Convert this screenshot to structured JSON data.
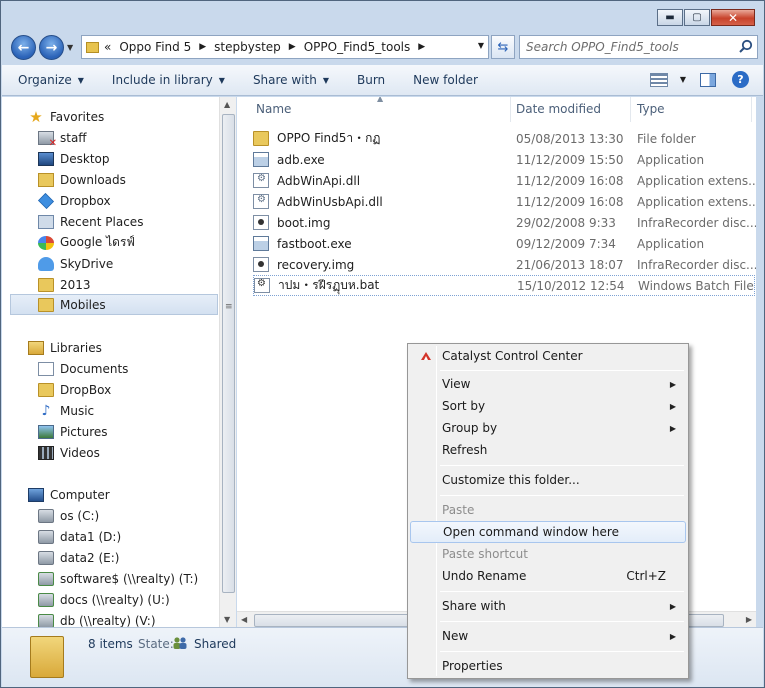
{
  "window": {
    "minimize_label": "▬",
    "maximize_label": "▢",
    "close_label": "✕"
  },
  "address": {
    "chevron": "«",
    "crumbs": [
      "Oppo Find 5",
      "stepbystep",
      "OPPO_Find5_tools"
    ],
    "search_placeholder": "Search OPPO_Find5_tools"
  },
  "toolbar": {
    "organize": "Organize",
    "include": "Include in library",
    "share": "Share with",
    "burn": "Burn",
    "new_folder": "New folder"
  },
  "sidebar": {
    "favorites": {
      "header": "Favorites",
      "items": [
        {
          "label": "staff",
          "icon": "network-drive-disconnected-icon"
        },
        {
          "label": "Desktop",
          "icon": "desktop-icon"
        },
        {
          "label": "Downloads",
          "icon": "downloads-icon"
        },
        {
          "label": "Dropbox",
          "icon": "dropbox-icon"
        },
        {
          "label": "Recent Places",
          "icon": "recent-places-icon"
        },
        {
          "label": "Google ไดรฟ์",
          "icon": "google-drive-icon"
        },
        {
          "label": "SkyDrive",
          "icon": "skydrive-icon"
        },
        {
          "label": "2013",
          "icon": "folder-icon"
        },
        {
          "label": "Mobiles",
          "icon": "folder-icon"
        }
      ]
    },
    "libraries": {
      "header": "Libraries",
      "items": [
        {
          "label": "Documents",
          "icon": "documents-icon"
        },
        {
          "label": "DropBox",
          "icon": "folder-icon"
        },
        {
          "label": "Music",
          "icon": "music-icon"
        },
        {
          "label": "Pictures",
          "icon": "pictures-icon"
        },
        {
          "label": "Videos",
          "icon": "videos-icon"
        }
      ]
    },
    "computer": {
      "header": "Computer",
      "items": [
        {
          "label": "os (C:)",
          "icon": "drive-icon"
        },
        {
          "label": "data1 (D:)",
          "icon": "drive-icon"
        },
        {
          "label": "data2 (E:)",
          "icon": "drive-icon"
        },
        {
          "label": "software$ (\\\\realty) (T:)",
          "icon": "network-drive-icon"
        },
        {
          "label": "docs (\\\\realty) (U:)",
          "icon": "network-drive-icon"
        },
        {
          "label": "db (\\\\realty) (V:)",
          "icon": "network-drive-icon"
        }
      ]
    }
  },
  "filelist": {
    "columns": {
      "name": "Name",
      "date": "Date modified",
      "type": "Type"
    },
    "rows": [
      {
        "name": "OPPO Find5า・กฏ",
        "date": "05/08/2013 13:30",
        "type": "File folder",
        "icon": "folder-icon"
      },
      {
        "name": "adb.exe",
        "date": "11/12/2009 15:50",
        "type": "Application",
        "icon": "exe-icon"
      },
      {
        "name": "AdbWinApi.dll",
        "date": "11/12/2009 16:08",
        "type": "Application extens...",
        "icon": "dll-icon"
      },
      {
        "name": "AdbWinUsbApi.dll",
        "date": "11/12/2009 16:08",
        "type": "Application extens...",
        "icon": "dll-icon"
      },
      {
        "name": "boot.img",
        "date": "29/02/2008 9:33",
        "type": "InfraRecorder disc...",
        "icon": "disc-image-icon"
      },
      {
        "name": "fastboot.exe",
        "date": "09/12/2009 7:34",
        "type": "Application",
        "icon": "exe-icon"
      },
      {
        "name": "recovery.img",
        "date": "21/06/2013 18:07",
        "type": "InfraRecorder disc...",
        "icon": "disc-image-icon"
      },
      {
        "name": "าปม・รฝีรฏุบห.bat",
        "date": "15/10/2012 12:54",
        "type": "Windows Batch File",
        "icon": "batch-file-icon"
      }
    ]
  },
  "details": {
    "count": "8 items",
    "state_label": "State:",
    "state_value": "Shared"
  },
  "context_menu": {
    "items": [
      {
        "label": "Catalyst Control Center",
        "shortcut": "",
        "submenu": false,
        "disabled": false
      },
      {
        "label": "View",
        "shortcut": "",
        "submenu": true,
        "disabled": false
      },
      {
        "label": "Sort by",
        "shortcut": "",
        "submenu": true,
        "disabled": false
      },
      {
        "label": "Group by",
        "shortcut": "",
        "submenu": true,
        "disabled": false
      },
      {
        "label": "Refresh",
        "shortcut": "",
        "submenu": false,
        "disabled": false
      },
      {
        "label": "Customize this folder...",
        "shortcut": "",
        "submenu": false,
        "disabled": false
      },
      {
        "label": "Paste",
        "shortcut": "",
        "submenu": false,
        "disabled": true
      },
      {
        "label": "Open command window here",
        "shortcut": "",
        "submenu": false,
        "disabled": false,
        "hovered": true
      },
      {
        "label": "Paste shortcut",
        "shortcut": "",
        "submenu": false,
        "disabled": true
      },
      {
        "label": "Undo Rename",
        "shortcut": "Ctrl+Z",
        "submenu": false,
        "disabled": false
      },
      {
        "label": "Share with",
        "shortcut": "",
        "submenu": true,
        "disabled": false
      },
      {
        "label": "New",
        "shortcut": "",
        "submenu": true,
        "disabled": false
      },
      {
        "label": "Properties",
        "shortcut": "",
        "submenu": false,
        "disabled": false
      }
    ]
  }
}
